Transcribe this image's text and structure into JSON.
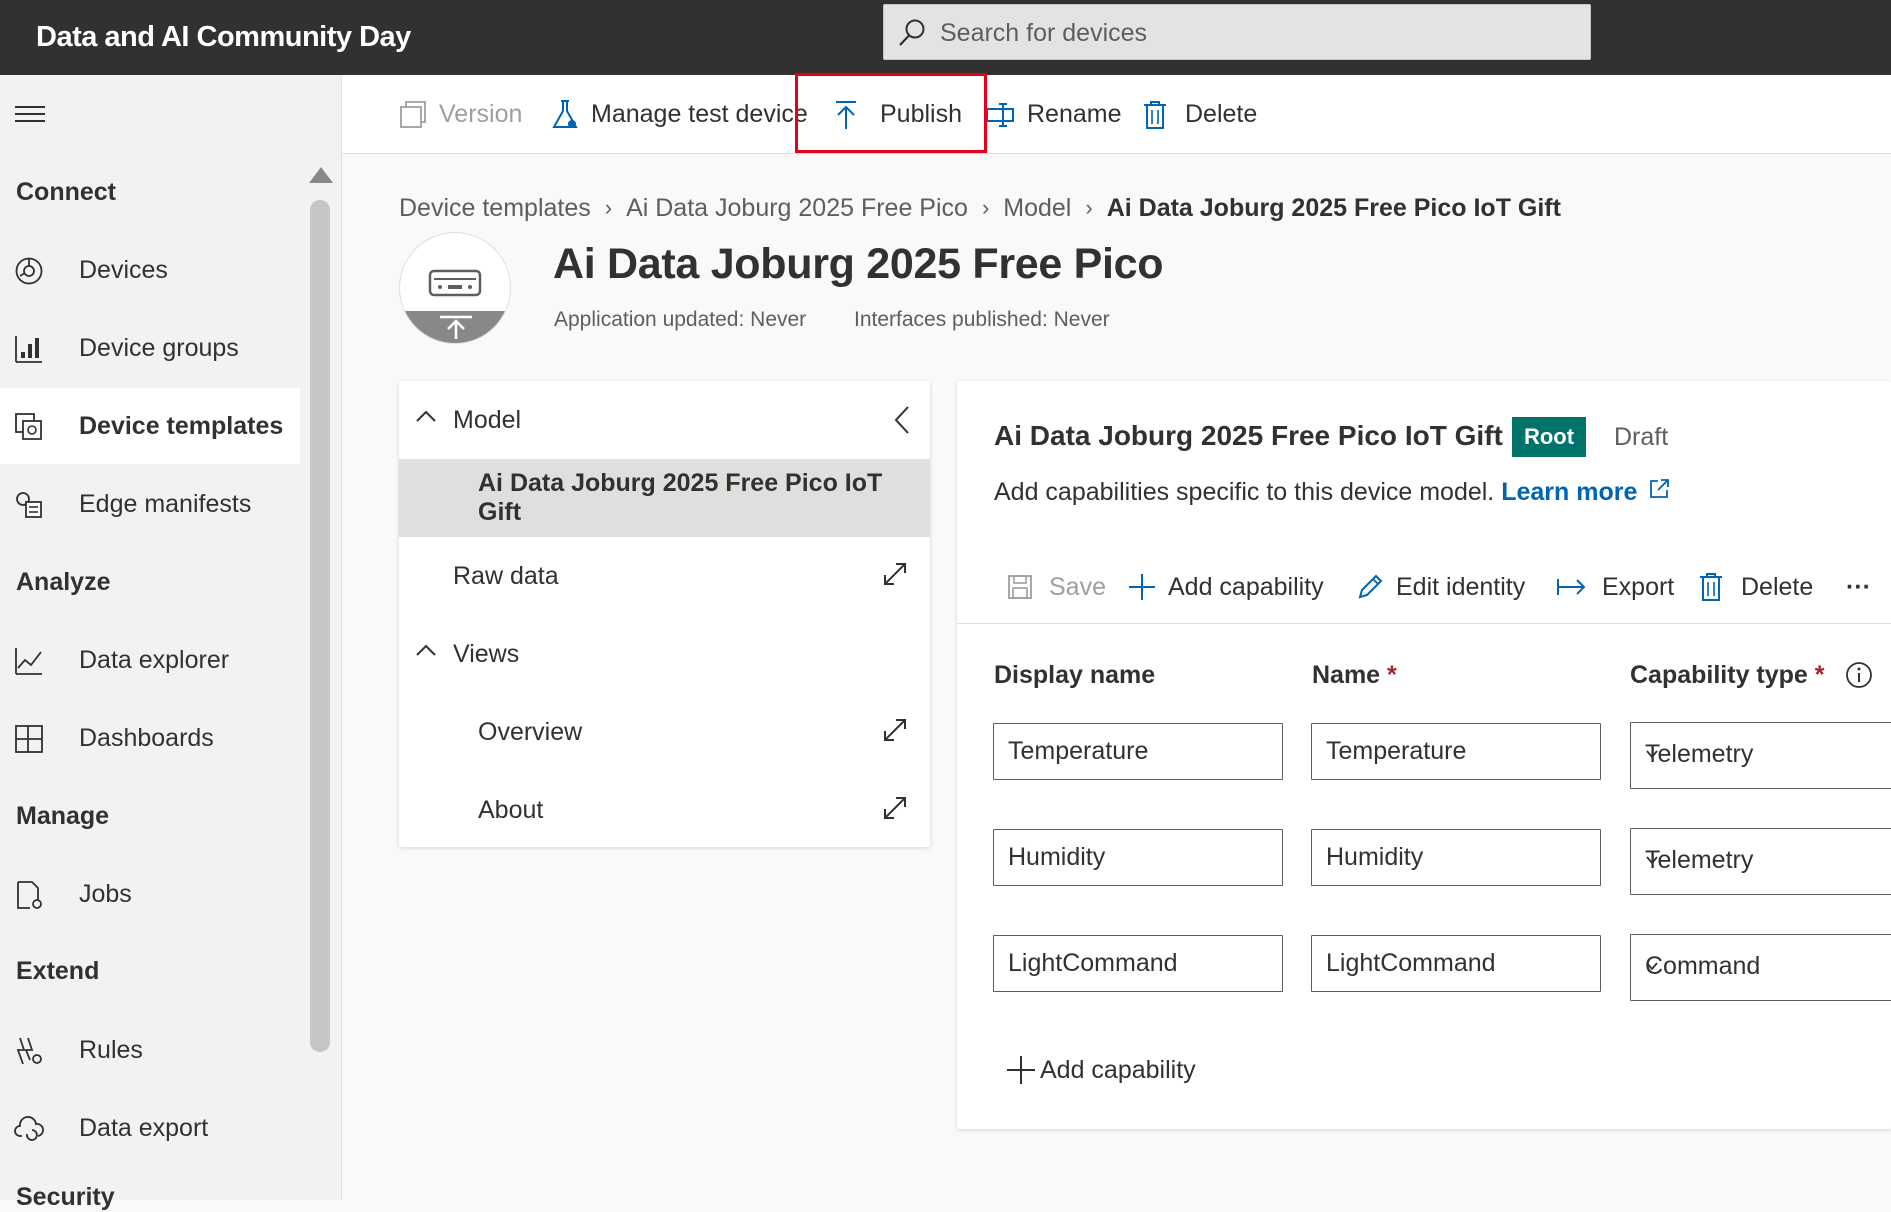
{
  "app": {
    "title": "Data and AI Community Day"
  },
  "search": {
    "placeholder": "Search for devices"
  },
  "toolbar": {
    "version": "Version",
    "manage_test_device": "Manage test device",
    "publish": "Publish",
    "rename": "Rename",
    "delete": "Delete"
  },
  "sidebar": {
    "sections": {
      "connect": "Connect",
      "analyze": "Analyze",
      "manage": "Manage",
      "extend": "Extend",
      "security_partial": "Security"
    },
    "items": [
      {
        "label": "Devices",
        "icon": "devices-icon"
      },
      {
        "label": "Device groups",
        "icon": "device-groups-icon"
      },
      {
        "label": "Device templates",
        "icon": "device-templates-icon",
        "active": true
      },
      {
        "label": "Edge manifests",
        "icon": "edge-manifests-icon"
      },
      {
        "label": "Data explorer",
        "icon": "data-explorer-icon"
      },
      {
        "label": "Dashboards",
        "icon": "dashboards-icon"
      },
      {
        "label": "Jobs",
        "icon": "jobs-icon"
      },
      {
        "label": "Rules",
        "icon": "rules-icon"
      },
      {
        "label": "Data export",
        "icon": "data-export-icon"
      }
    ]
  },
  "breadcrumb": [
    "Device templates",
    "Ai Data Joburg 2025 Free Pico",
    "Model",
    "Ai Data Joburg 2025 Free Pico IoT Gift"
  ],
  "header": {
    "title": "Ai Data Joburg 2025 Free Pico",
    "app_updated": "Application updated: Never",
    "interfaces_published": "Interfaces published: Never"
  },
  "tree": {
    "model": "Model",
    "model_item": "Ai Data Joburg 2025 Free Pico IoT Gift",
    "raw_data": "Raw data",
    "views": "Views",
    "overview": "Overview",
    "about": "About"
  },
  "editor": {
    "title": "Ai Data Joburg 2025 Free Pico IoT Gift",
    "badge": "Root",
    "status": "Draft",
    "description": "Add capabilities specific to this device model.",
    "learn_more": "Learn more",
    "toolbar": {
      "save": "Save",
      "add_capability": "Add capability",
      "edit_identity": "Edit identity",
      "export": "Export",
      "delete": "Delete",
      "more": "···"
    },
    "columns": {
      "display_name": "Display name",
      "name": "Name",
      "capability_type": "Capability type",
      "required_mark": "*"
    },
    "rows": [
      {
        "display_name": "Temperature",
        "name": "Temperature",
        "type": "Telemetry"
      },
      {
        "display_name": "Humidity",
        "name": "Humidity",
        "type": "Telemetry"
      },
      {
        "display_name": "LightCommand",
        "name": "LightCommand",
        "type": "Command"
      }
    ],
    "add_capability_bottom": "Add capability"
  },
  "colors": {
    "topbar": "#323130",
    "accent_blue": "#0064b5",
    "root_badge": "#00736b",
    "highlight": "#e3001b"
  }
}
